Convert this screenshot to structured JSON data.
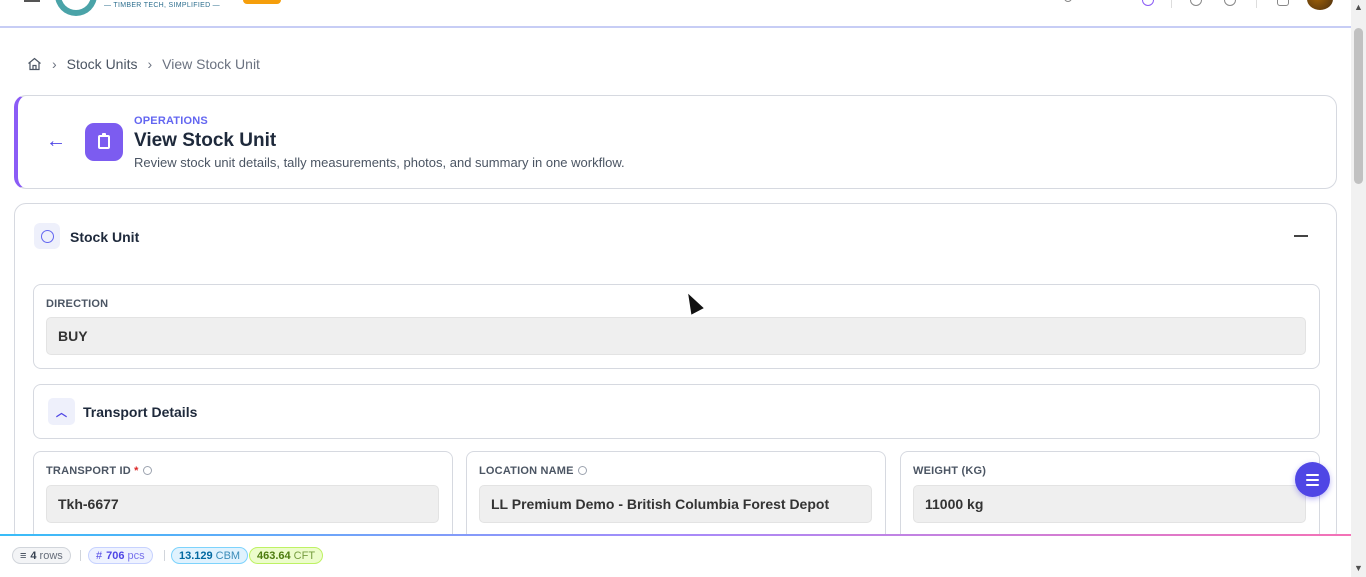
{
  "topbar": {
    "logo_tagline": "— TIMBER TECH, SIMPLIFIED —"
  },
  "breadcrumb": {
    "home_icon": "home-icon",
    "items": [
      "Stock Units",
      "View Stock Unit"
    ]
  },
  "header": {
    "kicker": "OPERATIONS",
    "title": "View Stock Unit",
    "subtitle": "Review stock unit details, tally measurements, photos, and summary in one workflow.",
    "icon": "clipboard-icon",
    "accent": "#8b5cf6"
  },
  "stock_unit": {
    "title": "Stock Unit",
    "direction": {
      "label": "DIRECTION",
      "value": "BUY"
    }
  },
  "transport": {
    "title": "Transport Details",
    "fields": [
      {
        "label": "TRANSPORT ID",
        "required": "*",
        "value": "Tkh-6677"
      },
      {
        "label": "LOCATION NAME",
        "value": "LL Premium Demo - British Columbia Forest Depot"
      },
      {
        "label": "WEIGHT (KG)",
        "value": "11000 kg"
      }
    ]
  },
  "summary": {
    "rows": {
      "value": "4",
      "unit": "rows"
    },
    "pcs": {
      "value": "706",
      "unit": "pcs",
      "prefix": "#"
    },
    "cbm": {
      "value": "13.129",
      "unit": "CBM"
    },
    "cft": {
      "value": "463.64",
      "unit": "CFT"
    }
  },
  "colors": {
    "primary": "#4f46e5",
    "brand_teal": "#4aa3a8",
    "badge": "#f59e0b"
  }
}
